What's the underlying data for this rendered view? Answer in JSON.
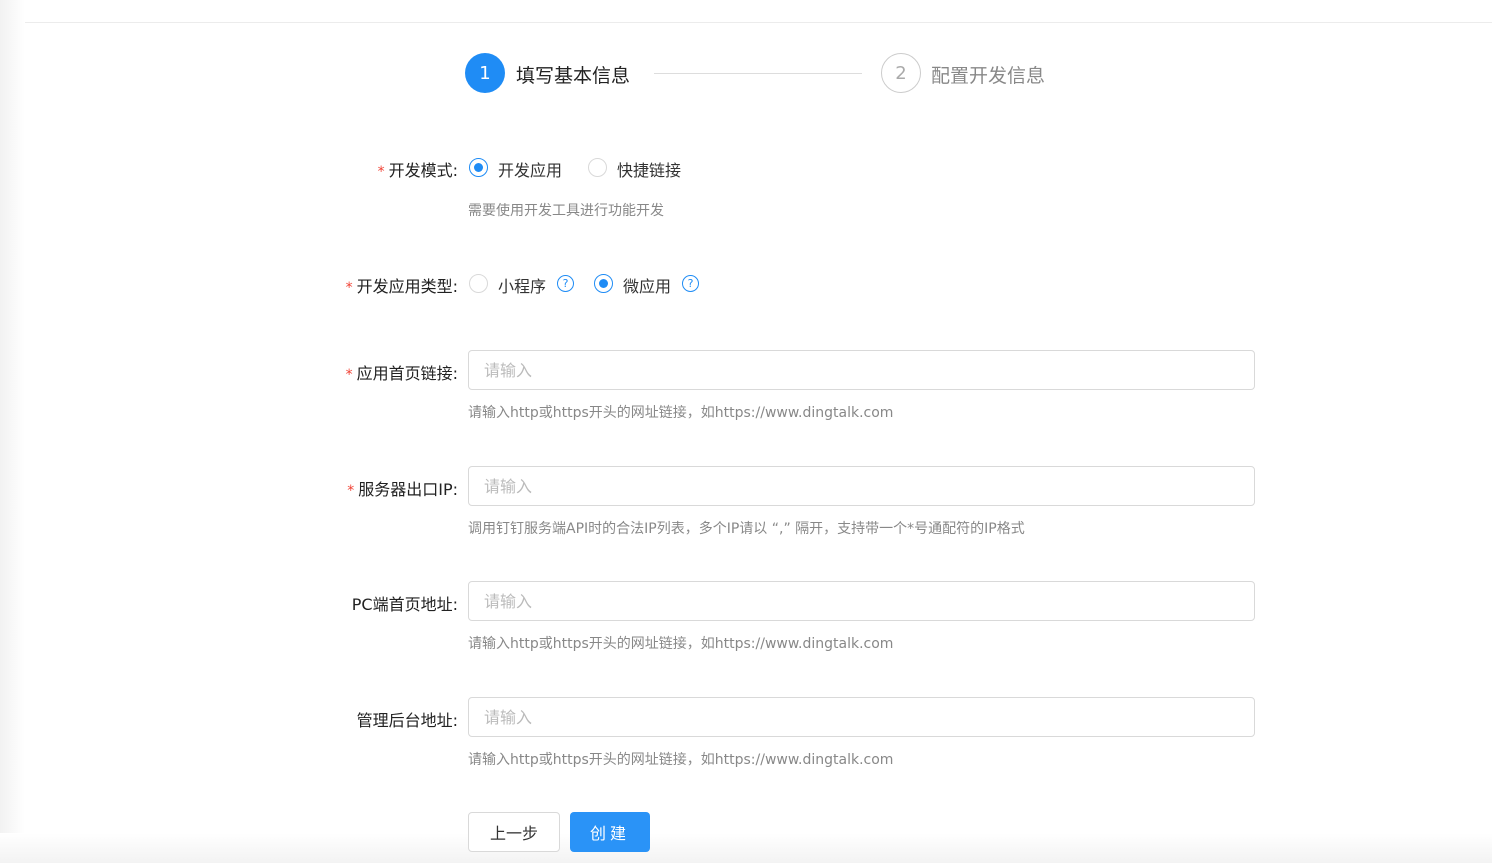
{
  "steps": [
    {
      "number": "1",
      "label": "填写基本信息"
    },
    {
      "number": "2",
      "label": "配置开发信息"
    }
  ],
  "form": {
    "dev_mode": {
      "label": "开发模式:",
      "options": [
        "开发应用",
        "快捷链接"
      ],
      "selected": "开发应用",
      "hint": "需要使用开发工具进行功能开发"
    },
    "app_type": {
      "label": "开发应用类型:",
      "options": [
        "小程序",
        "微应用"
      ],
      "selected": "微应用",
      "help_icon": "?"
    },
    "home_url": {
      "label": "应用首页链接:",
      "placeholder": "请输入",
      "value": "",
      "hint": "请输入http或https开头的网址链接，如https://www.dingtalk.com"
    },
    "server_ip": {
      "label": "服务器出口IP:",
      "placeholder": "请输入",
      "value": "",
      "hint": "调用钉钉服务端API时的合法IP列表，多个IP请以 “,” 隔开，支持带一个*号通配符的IP格式"
    },
    "pc_url": {
      "label": "PC端首页地址:",
      "placeholder": "请输入",
      "value": "",
      "hint": "请输入http或https开头的网址链接，如https://www.dingtalk.com"
    },
    "admin_url": {
      "label": "管理后台地址:",
      "placeholder": "请输入",
      "value": "",
      "hint": "请输入http或https开头的网址链接，如https://www.dingtalk.com"
    },
    "required_mark": "*"
  },
  "buttons": {
    "prev": "上一步",
    "create": "创建"
  }
}
